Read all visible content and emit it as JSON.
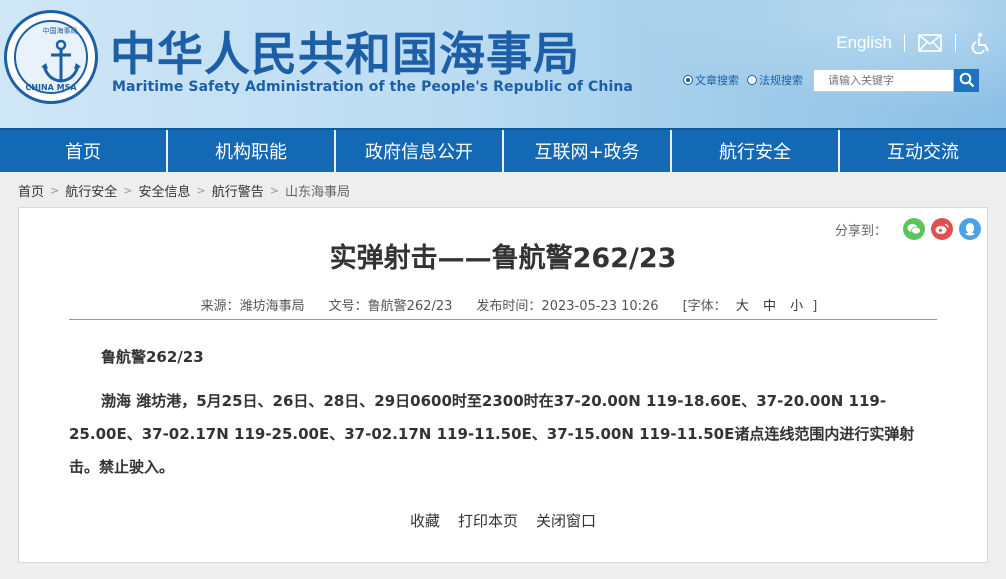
{
  "header": {
    "logo": {
      "top_text": "中国海事局",
      "bottom_text": "CHINA MSA"
    },
    "title_cn": "中华人民共和国海事局",
    "title_en": "Maritime Safety Administration of the People's Republic of China",
    "lang_link": "English",
    "icons": [
      "mail-icon",
      "accessibility-icon",
      "search-icon"
    ],
    "search": {
      "options": [
        {
          "label": "文章搜索",
          "selected": true
        },
        {
          "label": "法规搜索",
          "selected": false
        }
      ],
      "placeholder": "请输入关键字"
    }
  },
  "nav": {
    "items": [
      "首页",
      "机构职能",
      "政府信息公开",
      "互联网+政务",
      "航行安全",
      "互动交流"
    ]
  },
  "breadcrumb": [
    "首页",
    "航行安全",
    "安全信息",
    "航行警告",
    "山东海事局"
  ],
  "article": {
    "share_label": "分享到：",
    "share_icons": [
      "wechat-icon",
      "weibo-icon",
      "qq-icon"
    ],
    "title": "实弹射击——鲁航警262/23",
    "meta": {
      "source": "来源：潍坊海事局",
      "doc_no": "文号：鲁航警262/23",
      "publish_time": "发布时间：2023-05-23 10:26",
      "font_label": "[字体：",
      "font_large": "大",
      "font_medium": "中",
      "font_small": "小",
      "font_end": "]"
    },
    "paragraph_1": "鲁航警262/23",
    "paragraph_2": "渤海 潍坊港，5月25日、26日、28日、29日0600时至2300时在37-20.00N 119-18.60E、37-20.00N 119-25.00E、37-02.17N 119-25.00E、37-02.17N 119-11.50E、37-15.00N 119-11.50E诸点连线范围内进行实弹射击。禁止驶入。",
    "actions": [
      "收藏",
      "打印本页",
      "关闭窗口"
    ]
  },
  "colors": {
    "brand_blue": "#1c5ea7",
    "nav_blue": "#1469b5",
    "wechat_green": "#5cc45c",
    "weibo_red": "#e0524f",
    "qq_blue": "#4ba3e6"
  }
}
